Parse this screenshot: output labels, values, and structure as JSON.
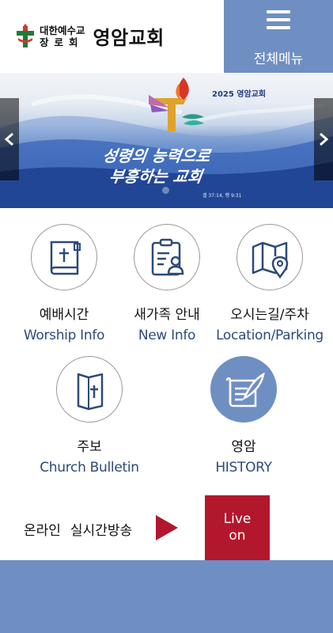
{
  "header": {
    "logo_line1": "대한예수교",
    "logo_line2": "장로회",
    "church_name": "영암교회",
    "menu_label": "전체메뉴"
  },
  "banner": {
    "year_label": "2025 영암교회",
    "slogan_line1": "성령의 능력으로",
    "slogan_line2": "부흥하는 교회",
    "verse": "겔 37:14, 행 9:31"
  },
  "quick_links": [
    {
      "korean": "예배시간",
      "english": "Worship Info",
      "icon": "bible-icon"
    },
    {
      "korean": "새가족 안내",
      "english": "New Info",
      "icon": "clipboard-person-icon"
    },
    {
      "korean": "오시는길/주차",
      "english": "Location/Parking",
      "icon": "map-pin-icon"
    },
    {
      "korean": "주보",
      "english": "Church Bulletin",
      "icon": "bulletin-cross-icon"
    },
    {
      "korean": "영암",
      "english": "HISTORY",
      "icon": "scroll-quill-icon"
    }
  ],
  "live": {
    "label_part1": "온라인",
    "label_part2": "실시간방송",
    "button_line1": "Live",
    "button_line2": "on"
  },
  "colors": {
    "accent_blue": "#6f8fc3",
    "live_red": "#b3172d",
    "english_text": "#2c4a7a"
  }
}
